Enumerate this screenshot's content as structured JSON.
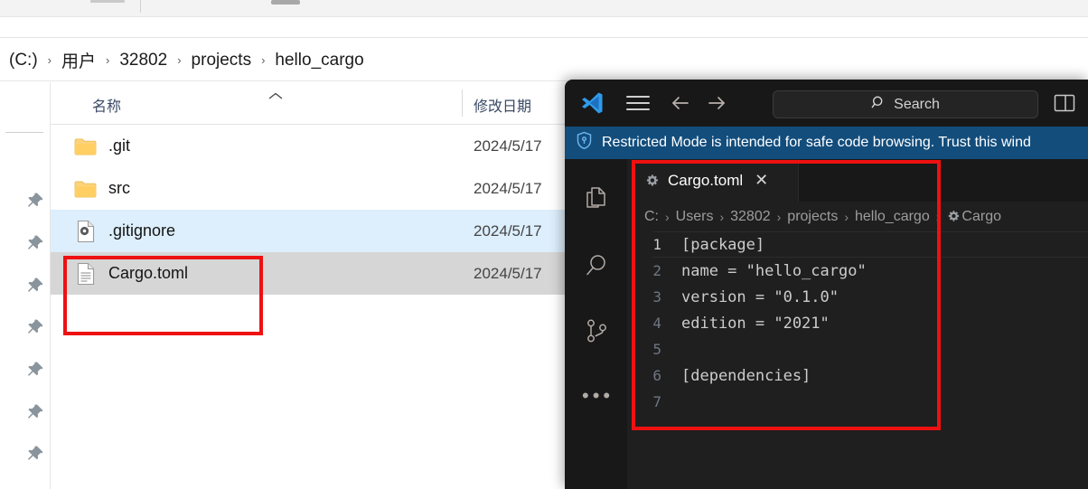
{
  "explorer": {
    "breadcrumb": {
      "items": [
        "(C:)",
        "用户",
        "32802",
        "projects",
        "hello_cargo"
      ],
      "separator": "›"
    },
    "columns": {
      "name": "名称",
      "date_modified": "修改日期",
      "sort_indicator": "ascending"
    },
    "files": [
      {
        "name": ".git",
        "icon": "folder-icon",
        "date": "2024/5/17",
        "state": "none"
      },
      {
        "name": "src",
        "icon": "folder-icon",
        "date": "2024/5/17",
        "state": "none"
      },
      {
        "name": ".gitignore",
        "icon": "config-file-icon",
        "date": "2024/5/17",
        "state": "selected-light"
      },
      {
        "name": "Cargo.toml",
        "icon": "document-file-icon",
        "date": "2024/5/17",
        "state": "selected-grey"
      }
    ],
    "pins": [
      "pin-icon",
      "pin-icon",
      "pin-icon",
      "pin-icon",
      "pin-icon",
      "pin-icon",
      "pin-icon"
    ]
  },
  "vscode": {
    "titlebar": {
      "logo": "vscode-logo-icon",
      "menu": "hamburger-menu-icon",
      "back": "arrow-left-icon",
      "forward": "arrow-right-icon",
      "search_placeholder": "Search",
      "search_icon": "magnifier-icon",
      "layout_icon": "toggle-panel-icon"
    },
    "trust_banner": {
      "icon": "shield-icon",
      "text": "Restricted Mode is intended for safe code browsing. Trust this wind"
    },
    "activity_bar": [
      {
        "name": "explorer",
        "icon": "files-icon"
      },
      {
        "name": "search",
        "icon": "magnifier-icon"
      },
      {
        "name": "source-control",
        "icon": "source-control-icon"
      },
      {
        "name": "more",
        "icon": "ellipsis-icon",
        "label": "•••"
      }
    ],
    "tab": {
      "icon": "toml-gear-icon",
      "label": "Cargo.toml",
      "close": "✕"
    },
    "breadcrumb": {
      "items": [
        "C:",
        "Users",
        "32802",
        "projects",
        "hello_cargo"
      ],
      "file_icon": "toml-gear-icon",
      "file": "Cargo",
      "separator": "›"
    },
    "editor": {
      "lines": [
        {
          "num": "1",
          "text": "[package]",
          "current": true
        },
        {
          "num": "2",
          "text": "name = \"hello_cargo\"",
          "current": false
        },
        {
          "num": "3",
          "text": "version = \"0.1.0\"",
          "current": false
        },
        {
          "num": "4",
          "text": "edition = \"2021\"",
          "current": false
        },
        {
          "num": "5",
          "text": "",
          "current": false
        },
        {
          "num": "6",
          "text": "[dependencies]",
          "current": false
        },
        {
          "num": "7",
          "text": "",
          "current": false
        }
      ]
    }
  },
  "annotations": {
    "highlight_color": "#ee1111",
    "boxes": [
      {
        "name": "cargo-toml-file-highlight"
      },
      {
        "name": "cargo-toml-editor-highlight"
      }
    ]
  }
}
